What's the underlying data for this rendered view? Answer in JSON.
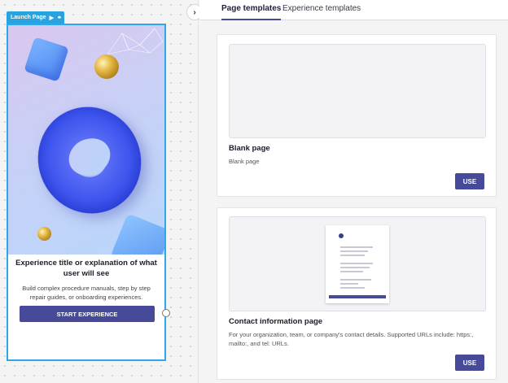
{
  "canvas": {
    "launch_tag": "Launch Page",
    "card": {
      "title": "Experience title or explanation of what user will see",
      "description": "Build complex procedure manuals, step by step repair guides, or onboarding experiences.",
      "button": "START EXPERIENCE"
    }
  },
  "panel": {
    "tabs": [
      {
        "label": "Page templates",
        "active": true
      },
      {
        "label": "Experience templates",
        "active": false
      }
    ],
    "templates": [
      {
        "title": "Blank page",
        "description": "Blank page",
        "button": "USE"
      },
      {
        "title": "Contact information page",
        "description": "For your organization, team, or company's contact details. Supported URLs include: https:, mailto:, and tel: URLs.",
        "button": "USE"
      }
    ]
  },
  "colors": {
    "accent": "#464a99",
    "selection": "#2ea8e8"
  },
  "icons": {
    "collapse": "chevron-right-icon",
    "play": "play-icon",
    "link": "link-icon"
  }
}
